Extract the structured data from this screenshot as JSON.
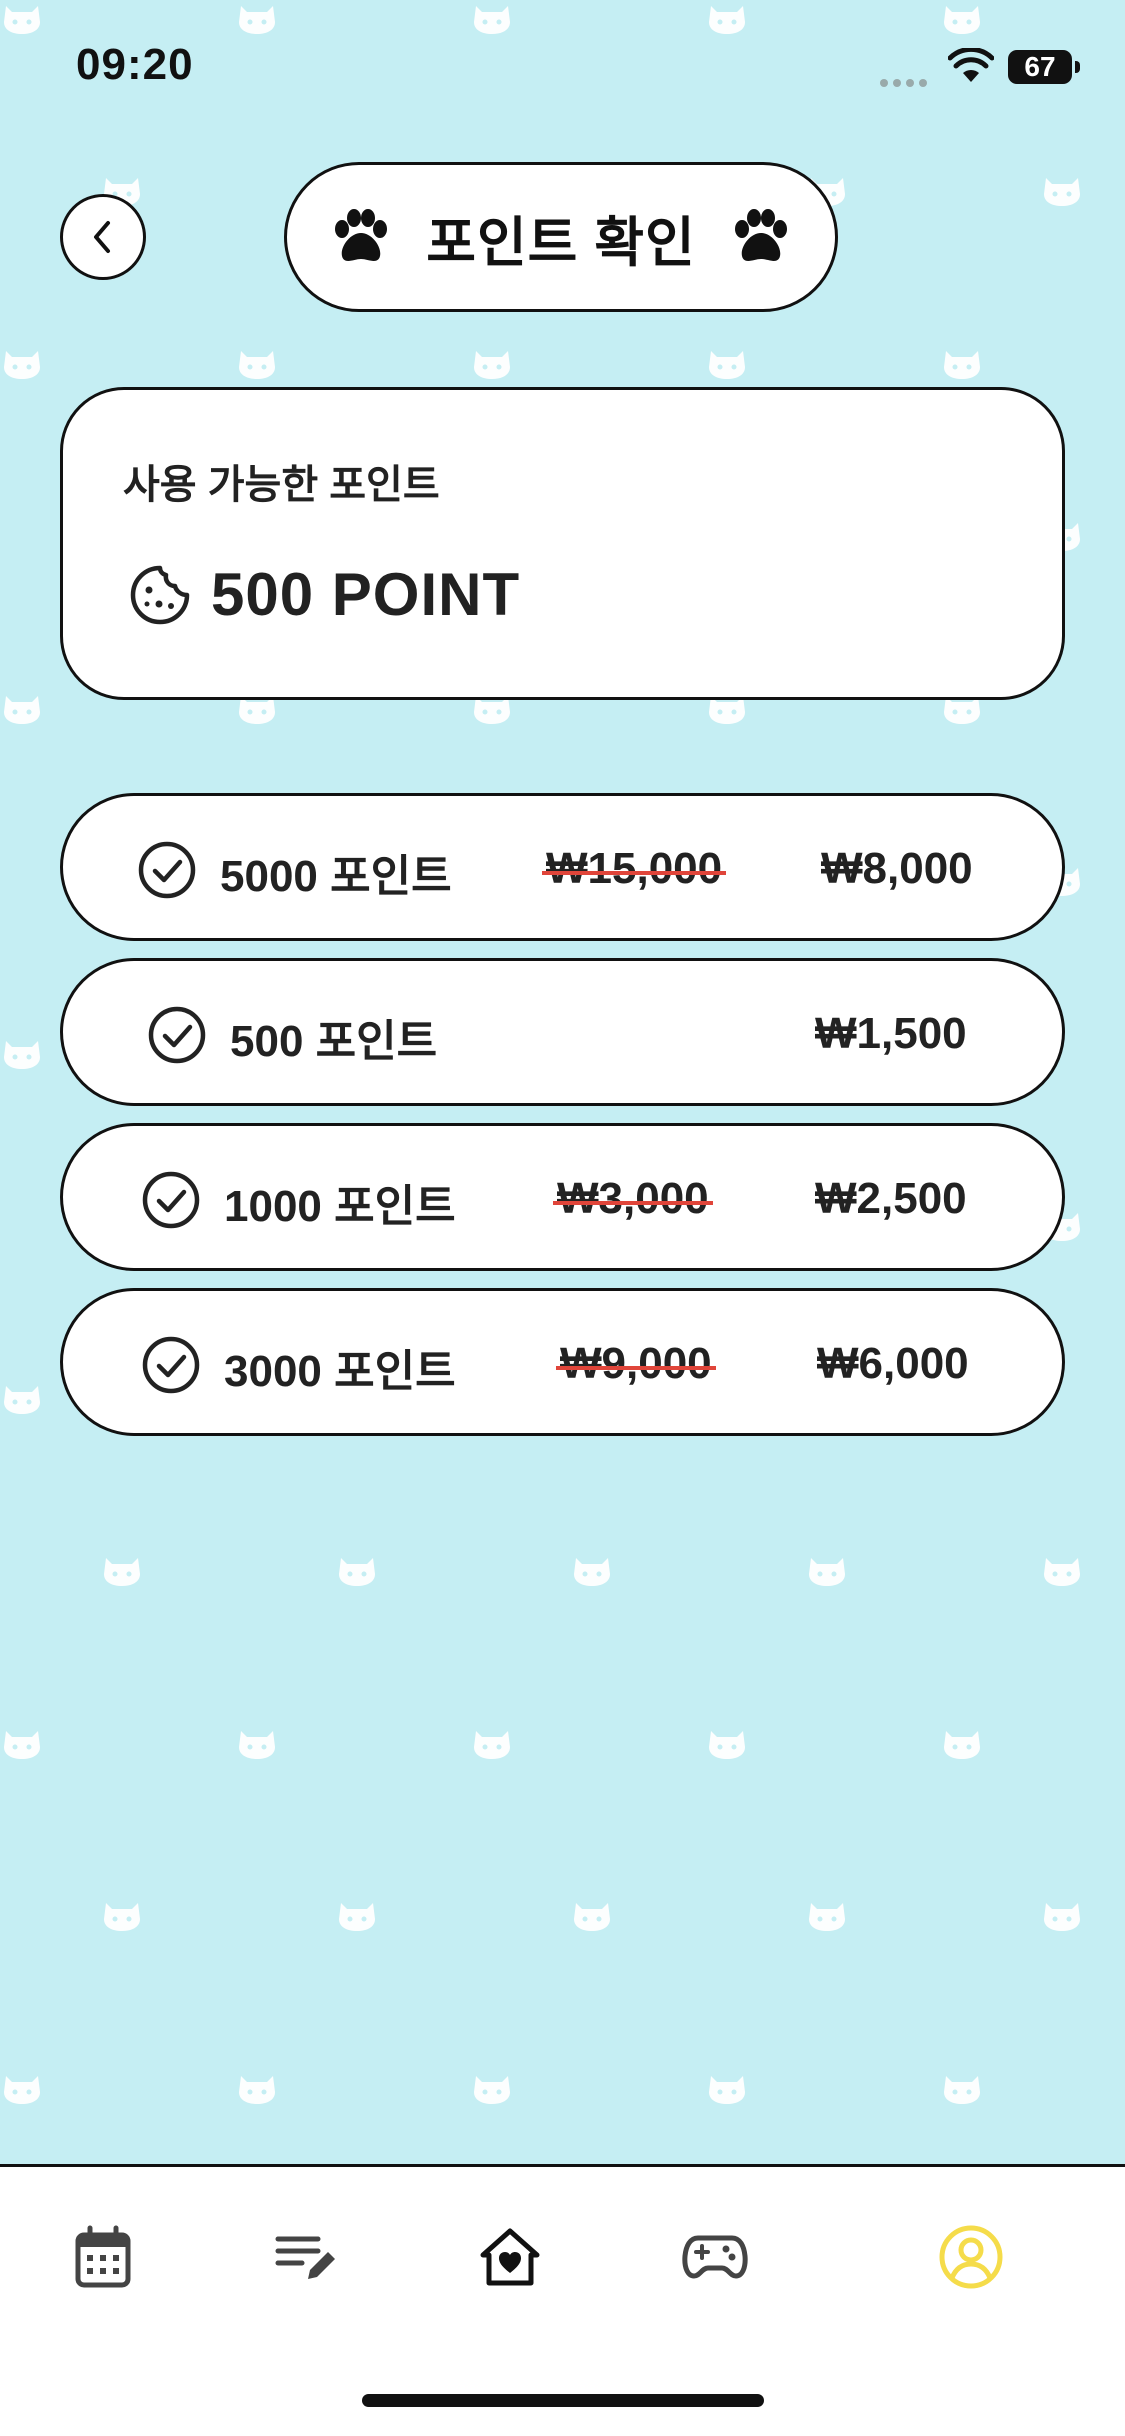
{
  "status_bar": {
    "time": "09:20",
    "battery": "67"
  },
  "header": {
    "title": "포인트 확인"
  },
  "balance": {
    "label": "사용 가능한 포인트",
    "value": "500 POINT"
  },
  "packages": [
    {
      "points": "5000 포인트",
      "original_price": "₩15,000",
      "price": "₩8,000"
    },
    {
      "points": "500 포인트",
      "original_price": "",
      "price": "₩1,500"
    },
    {
      "points": "1000 포인트",
      "original_price": "₩3,000",
      "price": "₩2,500"
    },
    {
      "points": "3000 포인트",
      "original_price": "₩9,000",
      "price": "₩6,000"
    }
  ],
  "nav": {
    "items": [
      {
        "icon": "calendar-icon"
      },
      {
        "icon": "edit-list-icon"
      },
      {
        "icon": "home-heart-icon"
      },
      {
        "icon": "gamepad-icon"
      },
      {
        "icon": "profile-icon",
        "active": true
      }
    ],
    "active_color": "#f5dc4a"
  },
  "colors": {
    "background": "#c5eef3",
    "strike": "#e0453a",
    "border": "#111111"
  }
}
